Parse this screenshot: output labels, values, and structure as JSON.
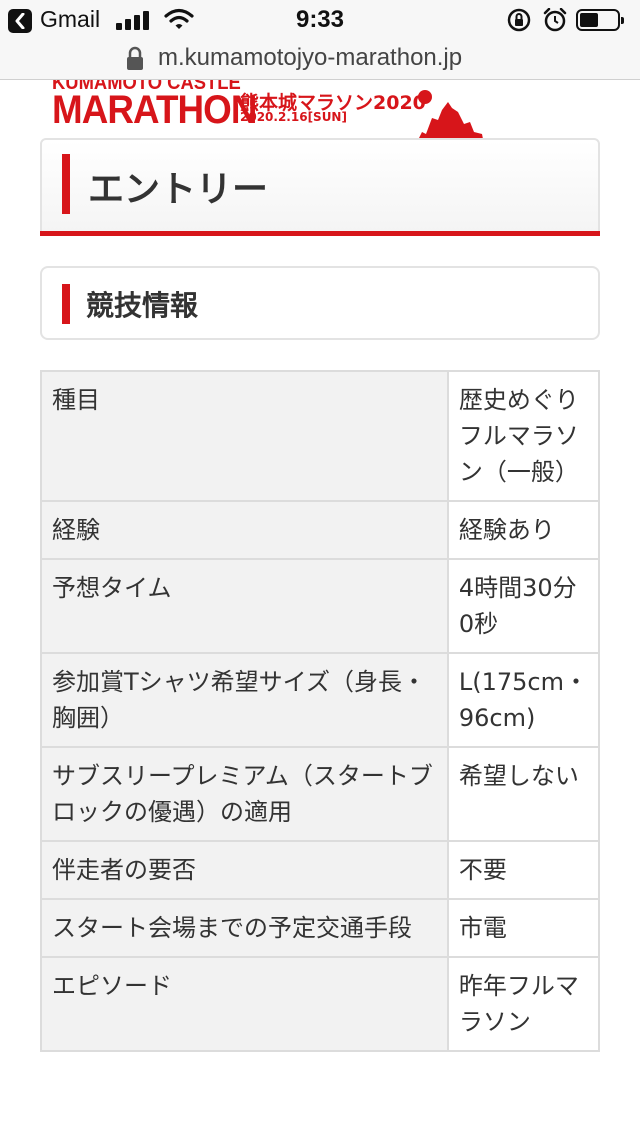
{
  "status_bar": {
    "back_app": "Gmail",
    "time": "9:33"
  },
  "url_bar": {
    "url": "m.kumamotojyo-marathon.jp"
  },
  "banner": {
    "logo_line1": "KUMAMOTO CASTLE",
    "logo_line2": "MARATHON",
    "logo_jp": "熊本城マラソン2020",
    "logo_date": "2020.2.16[SUN]",
    "accent_color": "#d7151a"
  },
  "page": {
    "title": "エントリー",
    "section_title": "競技情報"
  },
  "table": {
    "rows": [
      {
        "label": "種目",
        "value": "歴史めぐりフルマラソン（一般）"
      },
      {
        "label": "経験",
        "value": "経験あり"
      },
      {
        "label": "予想タイム",
        "value": "4時間30分0秒"
      },
      {
        "label": "参加賞Tシャツ希望サイズ（身長・胸囲）",
        "value": "L(175cm・96cm)"
      },
      {
        "label": "サブスリープレミアム（スタートブロックの優遇）の適用",
        "value": "希望しない"
      },
      {
        "label": "伴走者の要否",
        "value": "不要"
      },
      {
        "label": "スタート会場までの予定交通手段",
        "value": "市電"
      },
      {
        "label": "エピソード",
        "value": "昨年フルマラソン"
      }
    ]
  }
}
